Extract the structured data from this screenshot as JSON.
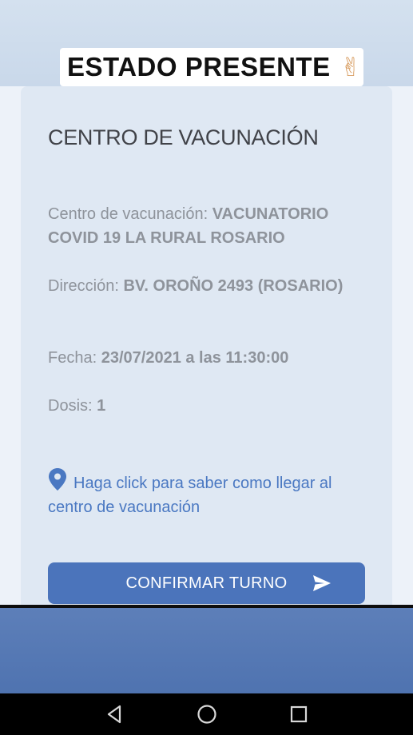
{
  "banner": {
    "text": "ESTADO PRESENTE",
    "emoji": "✌"
  },
  "card": {
    "title": "CENTRO DE VACUNACIÓN",
    "center_label": "Centro de vacunación:",
    "center_value": "VACUNATORIO COVID 19 LA RURAL ROSARIO",
    "address_label": "Dirección:",
    "address_value": "BV. OROÑO 2493 (ROSARIO)",
    "date_label": "Fecha:",
    "date_value": "23/07/2021 a las 11:30:00",
    "dose_label": "Dosis:",
    "dose_value": "1",
    "directions_link": "Haga click para saber como llegar al centro de vacunación",
    "confirm_button": "CONFIRMAR TURNO"
  },
  "icons": {
    "pin": "location-pin-icon",
    "send": "send-arrow-icon",
    "nav_back": "back-triangle-icon",
    "nav_home": "home-circle-icon",
    "nav_recents": "recents-square-icon"
  },
  "colors": {
    "accent": "#4b74bb",
    "link": "#4a78c2",
    "card_bg": "#dfe8f3",
    "label_gray": "#8e939b"
  }
}
